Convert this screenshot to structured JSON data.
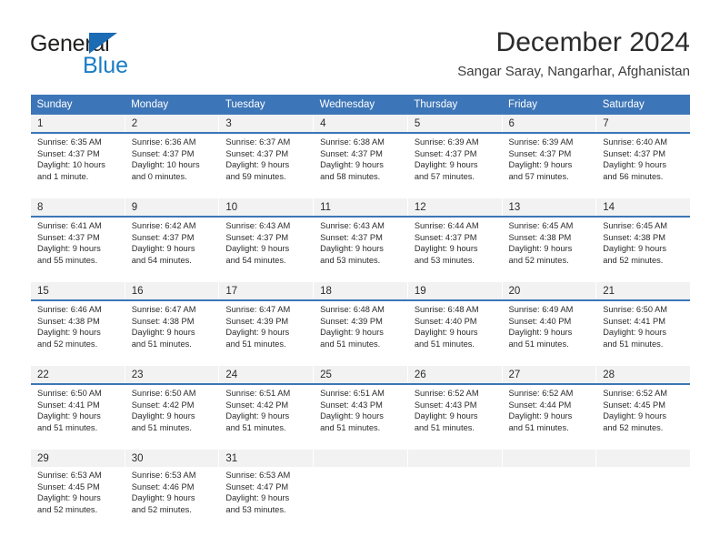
{
  "brand": {
    "word1": "General",
    "word2": "Blue",
    "triangle_color": "#1b6cb5",
    "blue_text_color": "#1b7cc4"
  },
  "header": {
    "title": "December 2024",
    "subtitle": "Sangar Saray, Nangarhar, Afghanistan",
    "header_bg": "#3d76b8",
    "daynum_bg": "#f2f2f2"
  },
  "calendar": {
    "weekday_headers": [
      "Sunday",
      "Monday",
      "Tuesday",
      "Wednesday",
      "Thursday",
      "Friday",
      "Saturday"
    ],
    "weeks": [
      [
        {
          "day": "1",
          "sunrise": "Sunrise: 6:35 AM",
          "sunset": "Sunset: 4:37 PM",
          "daylight1": "Daylight: 10 hours",
          "daylight2": "and 1 minute."
        },
        {
          "day": "2",
          "sunrise": "Sunrise: 6:36 AM",
          "sunset": "Sunset: 4:37 PM",
          "daylight1": "Daylight: 10 hours",
          "daylight2": "and 0 minutes."
        },
        {
          "day": "3",
          "sunrise": "Sunrise: 6:37 AM",
          "sunset": "Sunset: 4:37 PM",
          "daylight1": "Daylight: 9 hours",
          "daylight2": "and 59 minutes."
        },
        {
          "day": "4",
          "sunrise": "Sunrise: 6:38 AM",
          "sunset": "Sunset: 4:37 PM",
          "daylight1": "Daylight: 9 hours",
          "daylight2": "and 58 minutes."
        },
        {
          "day": "5",
          "sunrise": "Sunrise: 6:39 AM",
          "sunset": "Sunset: 4:37 PM",
          "daylight1": "Daylight: 9 hours",
          "daylight2": "and 57 minutes."
        },
        {
          "day": "6",
          "sunrise": "Sunrise: 6:39 AM",
          "sunset": "Sunset: 4:37 PM",
          "daylight1": "Daylight: 9 hours",
          "daylight2": "and 57 minutes."
        },
        {
          "day": "7",
          "sunrise": "Sunrise: 6:40 AM",
          "sunset": "Sunset: 4:37 PM",
          "daylight1": "Daylight: 9 hours",
          "daylight2": "and 56 minutes."
        }
      ],
      [
        {
          "day": "8",
          "sunrise": "Sunrise: 6:41 AM",
          "sunset": "Sunset: 4:37 PM",
          "daylight1": "Daylight: 9 hours",
          "daylight2": "and 55 minutes."
        },
        {
          "day": "9",
          "sunrise": "Sunrise: 6:42 AM",
          "sunset": "Sunset: 4:37 PM",
          "daylight1": "Daylight: 9 hours",
          "daylight2": "and 54 minutes."
        },
        {
          "day": "10",
          "sunrise": "Sunrise: 6:43 AM",
          "sunset": "Sunset: 4:37 PM",
          "daylight1": "Daylight: 9 hours",
          "daylight2": "and 54 minutes."
        },
        {
          "day": "11",
          "sunrise": "Sunrise: 6:43 AM",
          "sunset": "Sunset: 4:37 PM",
          "daylight1": "Daylight: 9 hours",
          "daylight2": "and 53 minutes."
        },
        {
          "day": "12",
          "sunrise": "Sunrise: 6:44 AM",
          "sunset": "Sunset: 4:37 PM",
          "daylight1": "Daylight: 9 hours",
          "daylight2": "and 53 minutes."
        },
        {
          "day": "13",
          "sunrise": "Sunrise: 6:45 AM",
          "sunset": "Sunset: 4:38 PM",
          "daylight1": "Daylight: 9 hours",
          "daylight2": "and 52 minutes."
        },
        {
          "day": "14",
          "sunrise": "Sunrise: 6:45 AM",
          "sunset": "Sunset: 4:38 PM",
          "daylight1": "Daylight: 9 hours",
          "daylight2": "and 52 minutes."
        }
      ],
      [
        {
          "day": "15",
          "sunrise": "Sunrise: 6:46 AM",
          "sunset": "Sunset: 4:38 PM",
          "daylight1": "Daylight: 9 hours",
          "daylight2": "and 52 minutes."
        },
        {
          "day": "16",
          "sunrise": "Sunrise: 6:47 AM",
          "sunset": "Sunset: 4:38 PM",
          "daylight1": "Daylight: 9 hours",
          "daylight2": "and 51 minutes."
        },
        {
          "day": "17",
          "sunrise": "Sunrise: 6:47 AM",
          "sunset": "Sunset: 4:39 PM",
          "daylight1": "Daylight: 9 hours",
          "daylight2": "and 51 minutes."
        },
        {
          "day": "18",
          "sunrise": "Sunrise: 6:48 AM",
          "sunset": "Sunset: 4:39 PM",
          "daylight1": "Daylight: 9 hours",
          "daylight2": "and 51 minutes."
        },
        {
          "day": "19",
          "sunrise": "Sunrise: 6:48 AM",
          "sunset": "Sunset: 4:40 PM",
          "daylight1": "Daylight: 9 hours",
          "daylight2": "and 51 minutes."
        },
        {
          "day": "20",
          "sunrise": "Sunrise: 6:49 AM",
          "sunset": "Sunset: 4:40 PM",
          "daylight1": "Daylight: 9 hours",
          "daylight2": "and 51 minutes."
        },
        {
          "day": "21",
          "sunrise": "Sunrise: 6:50 AM",
          "sunset": "Sunset: 4:41 PM",
          "daylight1": "Daylight: 9 hours",
          "daylight2": "and 51 minutes."
        }
      ],
      [
        {
          "day": "22",
          "sunrise": "Sunrise: 6:50 AM",
          "sunset": "Sunset: 4:41 PM",
          "daylight1": "Daylight: 9 hours",
          "daylight2": "and 51 minutes."
        },
        {
          "day": "23",
          "sunrise": "Sunrise: 6:50 AM",
          "sunset": "Sunset: 4:42 PM",
          "daylight1": "Daylight: 9 hours",
          "daylight2": "and 51 minutes."
        },
        {
          "day": "24",
          "sunrise": "Sunrise: 6:51 AM",
          "sunset": "Sunset: 4:42 PM",
          "daylight1": "Daylight: 9 hours",
          "daylight2": "and 51 minutes."
        },
        {
          "day": "25",
          "sunrise": "Sunrise: 6:51 AM",
          "sunset": "Sunset: 4:43 PM",
          "daylight1": "Daylight: 9 hours",
          "daylight2": "and 51 minutes."
        },
        {
          "day": "26",
          "sunrise": "Sunrise: 6:52 AM",
          "sunset": "Sunset: 4:43 PM",
          "daylight1": "Daylight: 9 hours",
          "daylight2": "and 51 minutes."
        },
        {
          "day": "27",
          "sunrise": "Sunrise: 6:52 AM",
          "sunset": "Sunset: 4:44 PM",
          "daylight1": "Daylight: 9 hours",
          "daylight2": "and 51 minutes."
        },
        {
          "day": "28",
          "sunrise": "Sunrise: 6:52 AM",
          "sunset": "Sunset: 4:45 PM",
          "daylight1": "Daylight: 9 hours",
          "daylight2": "and 52 minutes."
        }
      ],
      [
        {
          "day": "29",
          "sunrise": "Sunrise: 6:53 AM",
          "sunset": "Sunset: 4:45 PM",
          "daylight1": "Daylight: 9 hours",
          "daylight2": "and 52 minutes."
        },
        {
          "day": "30",
          "sunrise": "Sunrise: 6:53 AM",
          "sunset": "Sunset: 4:46 PM",
          "daylight1": "Daylight: 9 hours",
          "daylight2": "and 52 minutes."
        },
        {
          "day": "31",
          "sunrise": "Sunrise: 6:53 AM",
          "sunset": "Sunset: 4:47 PM",
          "daylight1": "Daylight: 9 hours",
          "daylight2": "and 53 minutes."
        },
        {
          "day": "",
          "sunrise": "",
          "sunset": "",
          "daylight1": "",
          "daylight2": ""
        },
        {
          "day": "",
          "sunrise": "",
          "sunset": "",
          "daylight1": "",
          "daylight2": ""
        },
        {
          "day": "",
          "sunrise": "",
          "sunset": "",
          "daylight1": "",
          "daylight2": ""
        },
        {
          "day": "",
          "sunrise": "",
          "sunset": "",
          "daylight1": "",
          "daylight2": ""
        }
      ]
    ]
  }
}
